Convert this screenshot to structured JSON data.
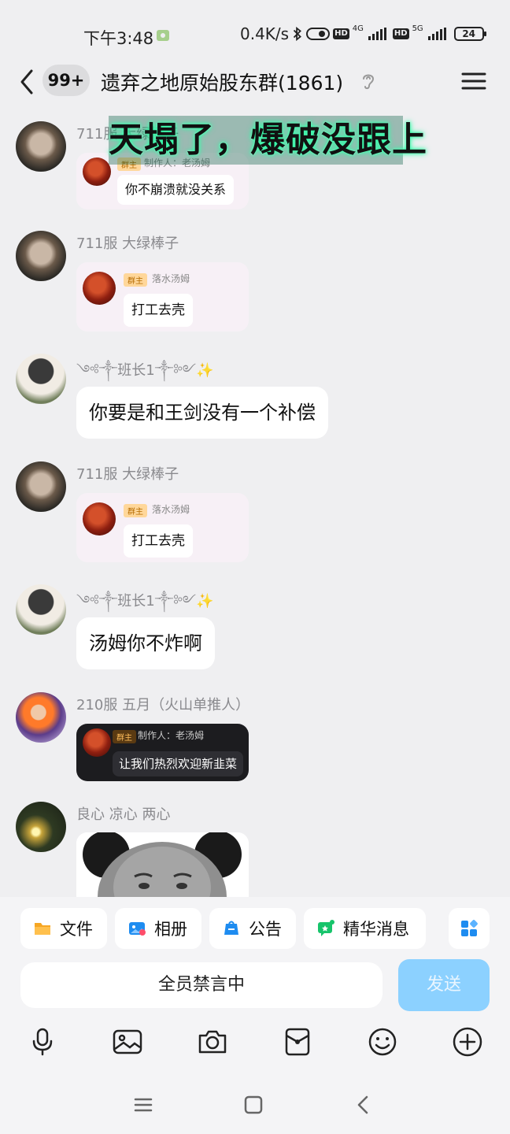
{
  "status_bar": {
    "time": "下午3:48",
    "net_speed": "0.4K/s",
    "battery": "24",
    "net1": "4G",
    "net2": "5G",
    "hd1": "HD",
    "hd2": "HD"
  },
  "header": {
    "unread": "99+",
    "title": "遗弃之地原始股东群(1861)"
  },
  "overlay_caption": "天塌了，爆破没跟上",
  "messages": [
    {
      "sender": "711服 大绿棒子",
      "card_role": "群主",
      "card_maker": "制作人：老汤姆",
      "card_text": "你不崩溃就没关系"
    },
    {
      "sender": "711服 大绿棒子",
      "card_role": "群主",
      "card_maker": "落水汤姆",
      "card_text": "打工去壳"
    },
    {
      "sender": "༺༒班长1༒༻✨",
      "text": "你要是和王剑没有一个补偿"
    },
    {
      "sender": "711服 大绿棒子",
      "card_role": "群主",
      "card_maker": "落水汤姆",
      "card_text": "打工去壳"
    },
    {
      "sender": "༺༒班长1༒༻✨",
      "text": "汤姆你不炸啊"
    },
    {
      "sender": "210服 五月（火山单推人）",
      "card_role": "群主",
      "card_maker": "制作人：老汤姆",
      "card_text": "让我们热烈欢迎新韭菜"
    },
    {
      "sender": "良心 凉心 两心"
    }
  ],
  "chips": {
    "files": "文件",
    "album": "相册",
    "notice": "公告",
    "featured": "精华消息"
  },
  "input": {
    "muted_text": "全员禁言中",
    "send": "发送"
  },
  "colors": {
    "send_button": "#8cd1ff",
    "role_badge": "#ffd79a",
    "accent_blue": "#1e8cf0"
  }
}
